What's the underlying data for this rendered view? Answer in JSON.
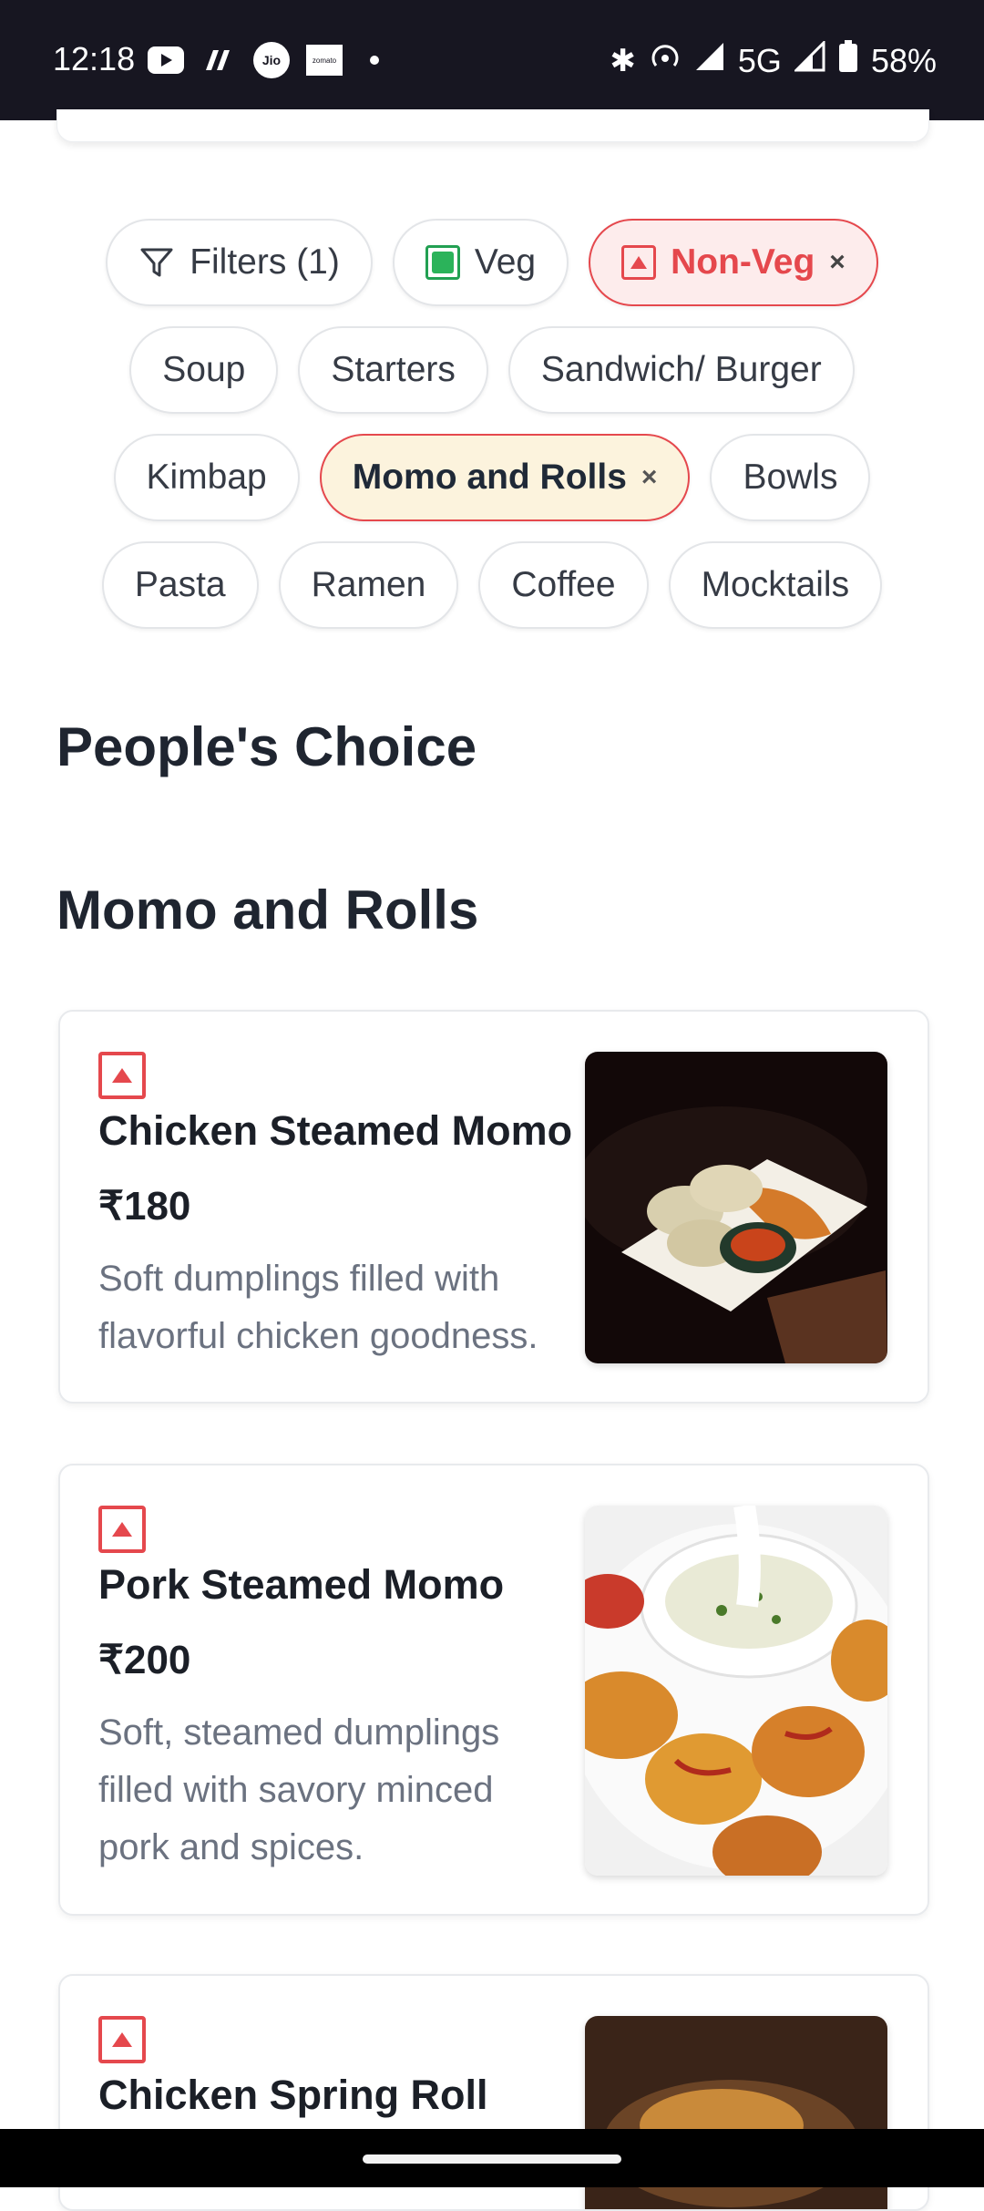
{
  "status_bar": {
    "time": "12:18",
    "network": "5G",
    "battery": "58%",
    "zomato_label": "zomato"
  },
  "filters": {
    "filters_label": "Filters (1)",
    "veg_label": "Veg",
    "nonveg_label": "Non-Veg",
    "remove_symbol": "×",
    "categories": [
      "Soup",
      "Starters",
      "Sandwich/ Burger",
      "Kimbap",
      "Momo and Rolls",
      "Bowls",
      "Pasta",
      "Ramen",
      "Coffee",
      "Mocktails"
    ],
    "selected_category": "Momo and Rolls"
  },
  "sections": {
    "peoples_choice": "People's Choice",
    "current": "Momo and Rolls"
  },
  "items": [
    {
      "name": "Chicken Steamed Momo",
      "price": "₹180",
      "description": "Soft dumplings filled with flavorful chicken goodness."
    },
    {
      "name": "Pork Steamed Momo",
      "price": "₹200",
      "description": "Soft, steamed dumplings filled with savory minced pork and spices."
    },
    {
      "name": "Chicken Spring Roll"
    }
  ],
  "colors": {
    "accent_red": "#e5484d",
    "veg_green": "#22a052",
    "selected_cream": "#fcf3dd",
    "status_bar_bg": "#171621"
  }
}
